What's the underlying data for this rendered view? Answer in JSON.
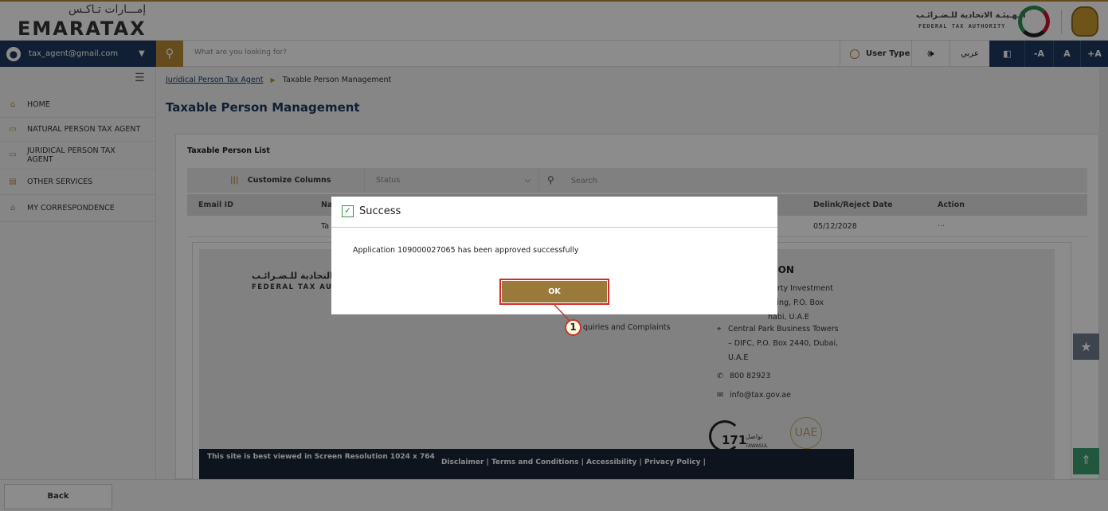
{
  "header": {
    "logo_ar": "إمـــارات تـاكـس",
    "logo_en": "EMARATAX",
    "fta_ar": "الـهـيئـة الاتحادية للـضـرائـب",
    "fta_en": "FEDERAL TAX AUTHORITY"
  },
  "navbar": {
    "user_email": "tax_agent@gmail.com",
    "search_placeholder": "What are you looking for?",
    "user_type": "User Type",
    "arabic": "عربي",
    "font_decrease": "-A",
    "font_reset": "A",
    "font_increase": "+A"
  },
  "sidebar": {
    "items": [
      {
        "label": "HOME"
      },
      {
        "label": "NATURAL PERSON TAX AGENT"
      },
      {
        "label": "JURIDICAL PERSON TAX AGENT"
      },
      {
        "label": "OTHER SERVICES"
      },
      {
        "label": "MY CORRESPONDENCE"
      }
    ]
  },
  "breadcrumb": {
    "parent": "Juridical Person Tax Agent",
    "current": "Taxable Person Management"
  },
  "main": {
    "title": "Taxable Person Management",
    "list_title": "Taxable Person List",
    "customize_columns": "Customize Columns",
    "status_placeholder": "Status",
    "search_placeholder": "Search",
    "columns": {
      "email": "Email ID",
      "name_partial": "Na",
      "delink_date": "Delink/Reject Date",
      "action": "Action"
    },
    "row": {
      "name_partial": "Ta",
      "delink_date": "05/12/2028",
      "action": "···"
    }
  },
  "preview": {
    "fta_ar": "التحادية للـضـرائـب",
    "fta_en": "FEDERAL TAX AU",
    "heading": "TION",
    "addr1": "perty Investment",
    "addr2": "ilding, P.O. Box",
    "addr3": "habi, U.A.E",
    "link_partial": "quiries and Complaints",
    "addr_b1": "Central Park Business Towers",
    "addr_b2": "– DIFC, P.O. Box 2440, Dubai,",
    "addr_b3": "U.A.E",
    "phone": "800 82923",
    "email": "info@tax.gov.ae",
    "tawasul": "TAWASUL",
    "tawasul_num": "171",
    "tawasul_ar": "تواصل",
    "uae": "UAE",
    "resolution_note": "This site is best viewed in Screen Resolution 1024 x 764",
    "footer_links": "Disclaimer   |   Terms and Conditions   |   Accessibility   |   Privacy Policy   |"
  },
  "bottom": {
    "back": "Back"
  },
  "modal": {
    "title": "Success",
    "message": "Application 109000027065 has been approved successfully",
    "ok": "OK",
    "callout": "1"
  },
  "colors": {
    "navy": "#1e3a5f",
    "gold": "#b68a35",
    "ok_button": "#9a7a3a",
    "highlight": "#d42a2a"
  }
}
